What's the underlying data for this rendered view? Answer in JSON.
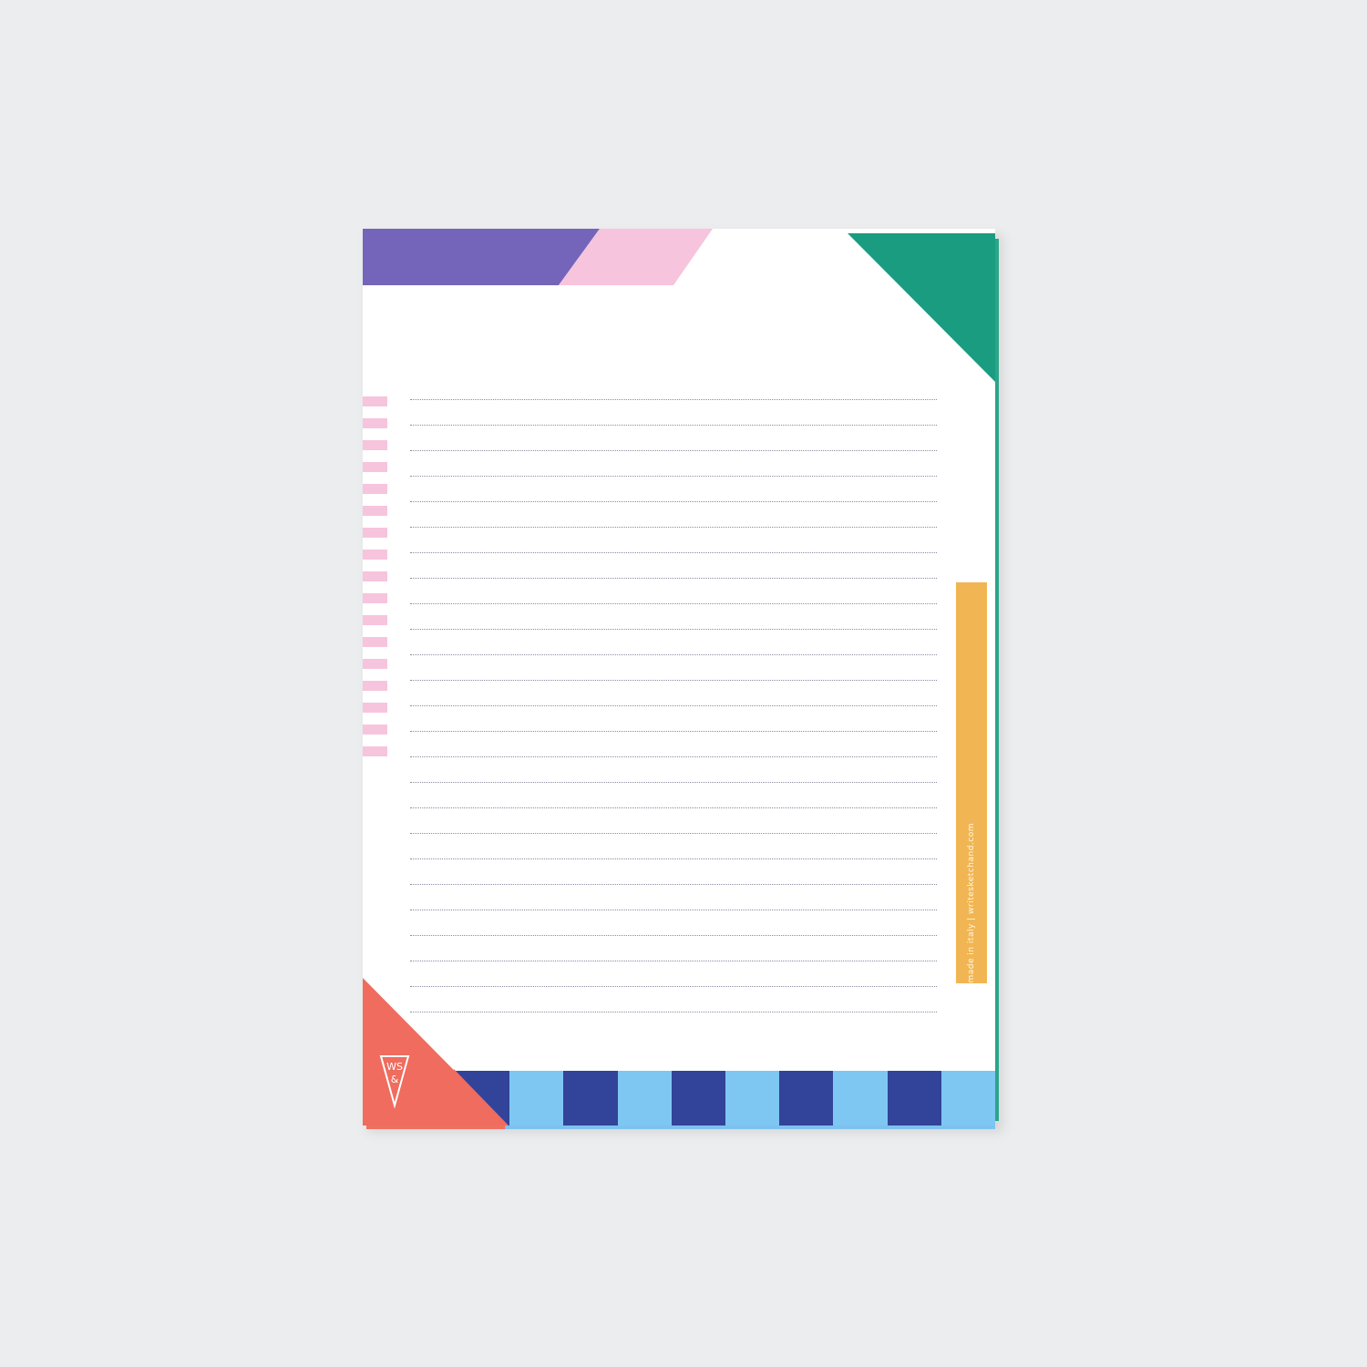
{
  "notepad": {
    "side_text": "made in italy | writesketchand.com",
    "logo_text": "WS&",
    "line_count": 25,
    "side_stripe_count": 17,
    "bottom_blocks": 10
  },
  "colors": {
    "background": "#ecedee",
    "paper": "#ffffff",
    "purple": "#7465bb",
    "pink": "#f7c4dd",
    "green": "#1a9c80",
    "yellow": "#f1b653",
    "coral": "#ef6c5e",
    "navy": "#32439a",
    "sky": "#7ec7f2",
    "line": "#8d8aa0"
  }
}
